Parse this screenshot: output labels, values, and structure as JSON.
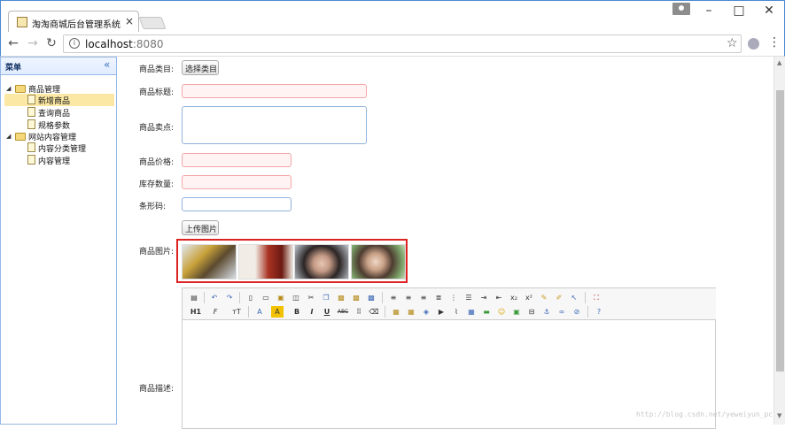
{
  "browser": {
    "tab_title": "淘淘商城后台管理系统",
    "tab_close": "×",
    "url_host": "localhost",
    "url_port": ":8080",
    "icons": [
      "favicon-icon",
      "close-icon",
      "back-icon",
      "forward-icon",
      "reload-icon",
      "info-icon",
      "star-icon",
      "extension-icon",
      "menu-icon",
      "minimize-icon",
      "maximize-icon",
      "window-close-icon",
      "user-icon"
    ]
  },
  "sidebar": {
    "title": "菜单",
    "collapse": "«",
    "tree": [
      {
        "label": "商品管理",
        "type": "folder",
        "expanded": true
      },
      {
        "label": "新增商品",
        "type": "file",
        "selected": true
      },
      {
        "label": "查询商品",
        "type": "file"
      },
      {
        "label": "规格参数",
        "type": "file"
      },
      {
        "label": "网站内容管理",
        "type": "folder",
        "expanded": true
      },
      {
        "label": "内容分类管理",
        "type": "file"
      },
      {
        "label": "内容管理",
        "type": "file"
      }
    ]
  },
  "form": {
    "category_label": "商品类目:",
    "category_button": "选择类目",
    "title_label": "商品标题:",
    "sellpoint_label": "商品卖点:",
    "price_label": "商品价格:",
    "stock_label": "库存数量:",
    "barcode_label": "条形码:",
    "upload_button": "上传图片",
    "images_label": "商品图片:",
    "images_count": 4,
    "desc_label": "商品描述:"
  },
  "editor": {
    "toolbar_row1": [
      "源码",
      "撤销",
      "重做",
      "预览",
      "打印",
      "模板",
      "代码",
      "剪切",
      "复制",
      "粘贴",
      "纯文本",
      "Word",
      "左对齐",
      "居中",
      "右对齐",
      "两端",
      "编号",
      "项目符号",
      "缩进",
      "减少缩进",
      "下标",
      "上标",
      "清除",
      "全选",
      "选择",
      "全屏"
    ],
    "h1": "H1",
    "font": "F",
    "size": "тT",
    "color_a": "A",
    "bold": "B",
    "italic": "I",
    "underline": "U",
    "strike": "ABC"
  },
  "watermark": "http://blog.csdn.net/yeweiyun_pc"
}
